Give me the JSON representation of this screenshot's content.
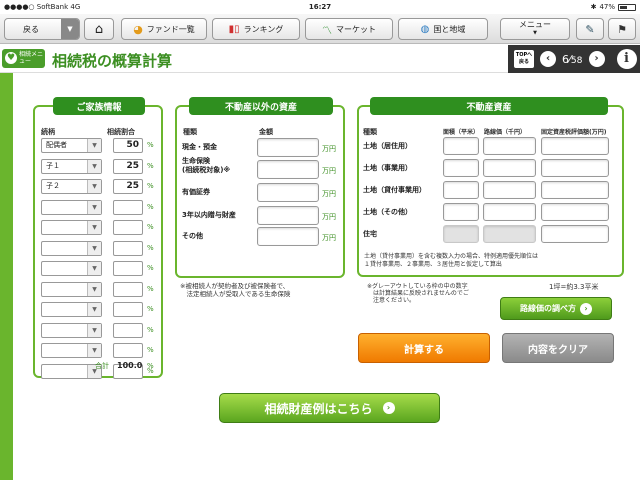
{
  "status": {
    "carrier": "●●●●○ SoftBank  4G",
    "time": "16:27",
    "battery": "47%"
  },
  "nav": {
    "back": "戻る",
    "fund": "ファンド一覧",
    "ranking": "ランキング",
    "market": "マーケット",
    "country": "国と地域",
    "menu": "メニュー"
  },
  "title": {
    "badge": "相続メニュー",
    "heading": "相続税の概算計算"
  },
  "pager": {
    "top": "TOPへ戻る",
    "current": "6",
    "total": "58"
  },
  "family": {
    "title": "ご家族情報",
    "col1": "続柄",
    "col2": "相続割合",
    "pct_unit": "%",
    "rows": [
      {
        "rel": "配偶者",
        "pct": "50"
      },
      {
        "rel": "子１",
        "pct": "25"
      },
      {
        "rel": "子２",
        "pct": "25"
      },
      {
        "rel": "",
        "pct": ""
      },
      {
        "rel": "",
        "pct": ""
      },
      {
        "rel": "",
        "pct": ""
      },
      {
        "rel": "",
        "pct": ""
      },
      {
        "rel": "",
        "pct": ""
      },
      {
        "rel": "",
        "pct": ""
      },
      {
        "rel": "",
        "pct": ""
      },
      {
        "rel": "",
        "pct": ""
      },
      {
        "rel": "",
        "pct": ""
      }
    ],
    "total_label": "合計",
    "total_value": "100.0",
    "total_unit": "%"
  },
  "nonre": {
    "title": "不動産以外の資産",
    "col1": "種類",
    "col2": "金額",
    "unit": "万円",
    "rows": [
      "現金・預金",
      "生命保険\n(相続税対象)※",
      "有価証券",
      "3年以内贈与財産",
      "その他"
    ],
    "note": "※被相続人が契約者及び被保険者で、\n　法定相続人が受取人である生命保険"
  },
  "re": {
    "title": "不動産資産",
    "col1": "種類",
    "col2": "面積（平米）",
    "col3": "路線価（千円）",
    "col4": "固定資産税評価額(万円)",
    "rows": [
      "土地（居住用）",
      "土地（事業用）",
      "土地（貸付事業用）",
      "土地（その他）",
      "住宅"
    ],
    "note": "土地（貸付事業用）を含む複数入力の場合、特例適用優先順位は\n１貸付事業用、２事業用、３居住用と仮定して算出",
    "gray_note": "※グレーアウトしている枠の中の数字\n　は計算結果に反映されませんのでご\n　注意ください。",
    "tsubo": "1坪=約3.3平米",
    "rosen_btn": "路線価の調べ方"
  },
  "actions": {
    "calc": "計算する",
    "clear": "内容をクリア",
    "example": "相続財産例はこちら"
  },
  "colors": {
    "accent": "#3c8f22",
    "panel_border": "#6ab52d",
    "calc": "#f07a00"
  }
}
